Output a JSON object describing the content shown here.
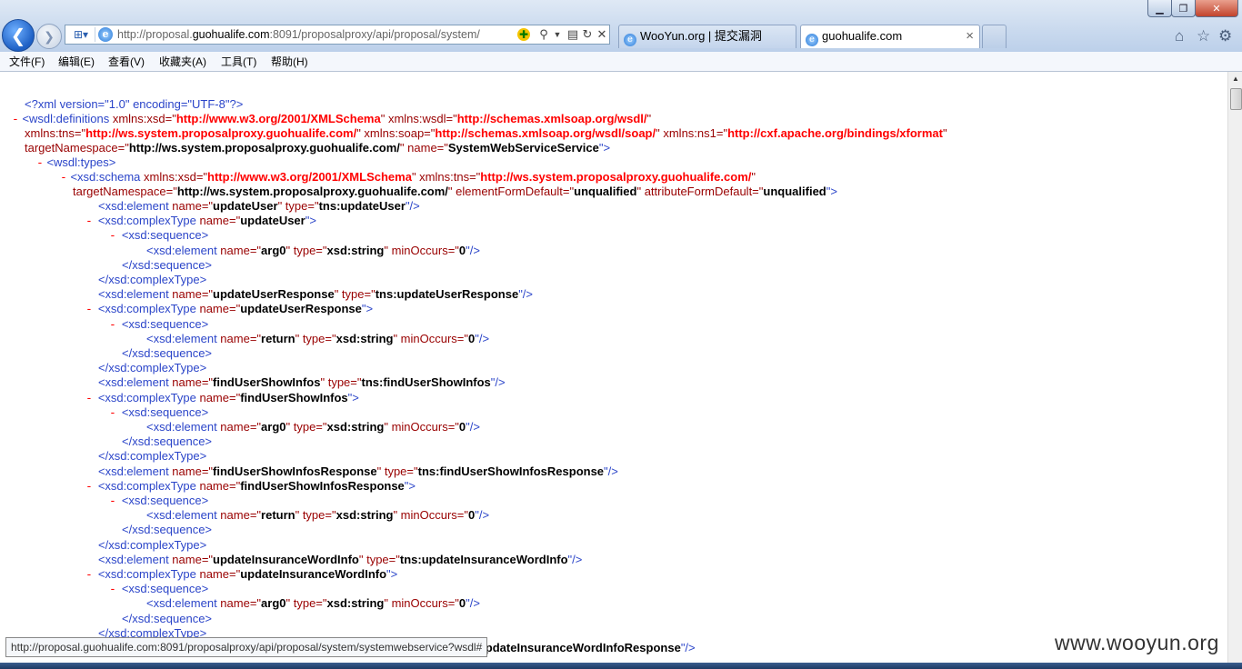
{
  "browser": {
    "address_url_pre": "http://proposal.",
    "address_url_host": "guohualife.com",
    "address_url_post": ":8091/proposalproxy/api/proposal/system/",
    "tabs": [
      {
        "title": "WooYun.org | 提交漏洞"
      },
      {
        "title": "guohualife.com"
      }
    ],
    "close_glyph": "×"
  },
  "menu": [
    "文件(F)",
    "编辑(E)",
    "查看(V)",
    "收藏夹(A)",
    "工具(T)",
    "帮助(H)"
  ],
  "status_url": "http://proposal.guohualife.com:8091/proposalproxy/api/proposal/system/systemwebservice?wsdl#",
  "watermark": "www.wooyun.org",
  "xml": {
    "decl": "<?xml version=\"1.0\" encoding=\"UTF-8\"?>",
    "minus": "-",
    "l1": {
      "open": "<wsdl:definitions ",
      "a1n": "xmlns:xsd=\"",
      "a1v": "http://www.w3.org/2001/XMLSchema",
      "a2n": "\" xmlns:wsdl=\"",
      "a2v": "http://schemas.xmlsoap.org/wsdl/",
      "end": "\""
    },
    "l2": {
      "a1n": "xmlns:tns=\"",
      "a1v": "http://ws.system.proposalproxy.guohualife.com/",
      "a2n": "\" xmlns:soap=\"",
      "a2v": "http://schemas.xmlsoap.org/wsdl/soap/",
      "a3n": "\" xmlns:ns1=\"",
      "a3v": "http://cxf.apache.org/bindings/xformat",
      "end": "\""
    },
    "l3": {
      "a1n": "targetNamespace=\"",
      "a1v": "http://ws.system.proposalproxy.guohualife.com/",
      "a2n": "\" name=\"",
      "a2v": "SystemWebServiceService",
      "end": "\">"
    },
    "types": "<wsdl:types>",
    "schema1": {
      "open": "<xsd:schema ",
      "a1n": "xmlns:xsd=\"",
      "a1v": "http://www.w3.org/2001/XMLSchema",
      "a2n": "\" xmlns:tns=\"",
      "a2v": "http://ws.system.proposalproxy.guohualife.com/",
      "end": "\""
    },
    "schema2": {
      "a1n": "targetNamespace=\"",
      "a1v": "http://ws.system.proposalproxy.guohualife.com/",
      "a2n": "\" elementFormDefault=\"",
      "a2v": "unqualified",
      "a3n": "\" attributeFormDefault=\"",
      "a3v": "unqualified",
      "end": "\">"
    },
    "tags": {
      "elem": "<xsd:element ",
      "ctype": "<xsd:complexType ",
      "ctype_close": "</xsd:complexType>",
      "seq": "<xsd:sequence>",
      "seq_close": "</xsd:sequence>",
      "name_attr": "name=\"",
      "type_attr": "\" type=\"",
      "min_attr": "\" minOccurs=\"",
      "selfclose": "\"/>",
      "gt": "\">"
    },
    "rows": [
      {
        "kind": "el",
        "name": "updateUser",
        "type": "tns:updateUser"
      },
      {
        "kind": "ct",
        "name": "updateUser"
      },
      {
        "kind": "seq"
      },
      {
        "kind": "inner",
        "name": "arg0",
        "type": "xsd:string",
        "min": "0"
      },
      {
        "kind": "seqc"
      },
      {
        "kind": "ctc"
      },
      {
        "kind": "el",
        "name": "updateUserResponse",
        "type": "tns:updateUserResponse"
      },
      {
        "kind": "ct",
        "name": "updateUserResponse"
      },
      {
        "kind": "seq"
      },
      {
        "kind": "inner",
        "name": "return",
        "type": "xsd:string",
        "min": "0"
      },
      {
        "kind": "seqc"
      },
      {
        "kind": "ctc"
      },
      {
        "kind": "el",
        "name": "findUserShowInfos",
        "type": "tns:findUserShowInfos"
      },
      {
        "kind": "ct",
        "name": "findUserShowInfos"
      },
      {
        "kind": "seq"
      },
      {
        "kind": "inner",
        "name": "arg0",
        "type": "xsd:string",
        "min": "0"
      },
      {
        "kind": "seqc"
      },
      {
        "kind": "ctc"
      },
      {
        "kind": "el",
        "name": "findUserShowInfosResponse",
        "type": "tns:findUserShowInfosResponse"
      },
      {
        "kind": "ct",
        "name": "findUserShowInfosResponse"
      },
      {
        "kind": "seq"
      },
      {
        "kind": "inner",
        "name": "return",
        "type": "xsd:string",
        "min": "0"
      },
      {
        "kind": "seqc"
      },
      {
        "kind": "ctc"
      },
      {
        "kind": "el",
        "name": "updateInsuranceWordInfo",
        "type": "tns:updateInsuranceWordInfo"
      },
      {
        "kind": "ct",
        "name": "updateInsuranceWordInfo"
      },
      {
        "kind": "seq"
      },
      {
        "kind": "inner",
        "name": "arg0",
        "type": "xsd:string",
        "min": "0"
      },
      {
        "kind": "seqc"
      },
      {
        "kind": "ctc"
      },
      {
        "kind": "el",
        "name": "updateInsuranceWordInfoResponse",
        "type": "tns:updateInsuranceWordInfoResponse"
      }
    ]
  }
}
